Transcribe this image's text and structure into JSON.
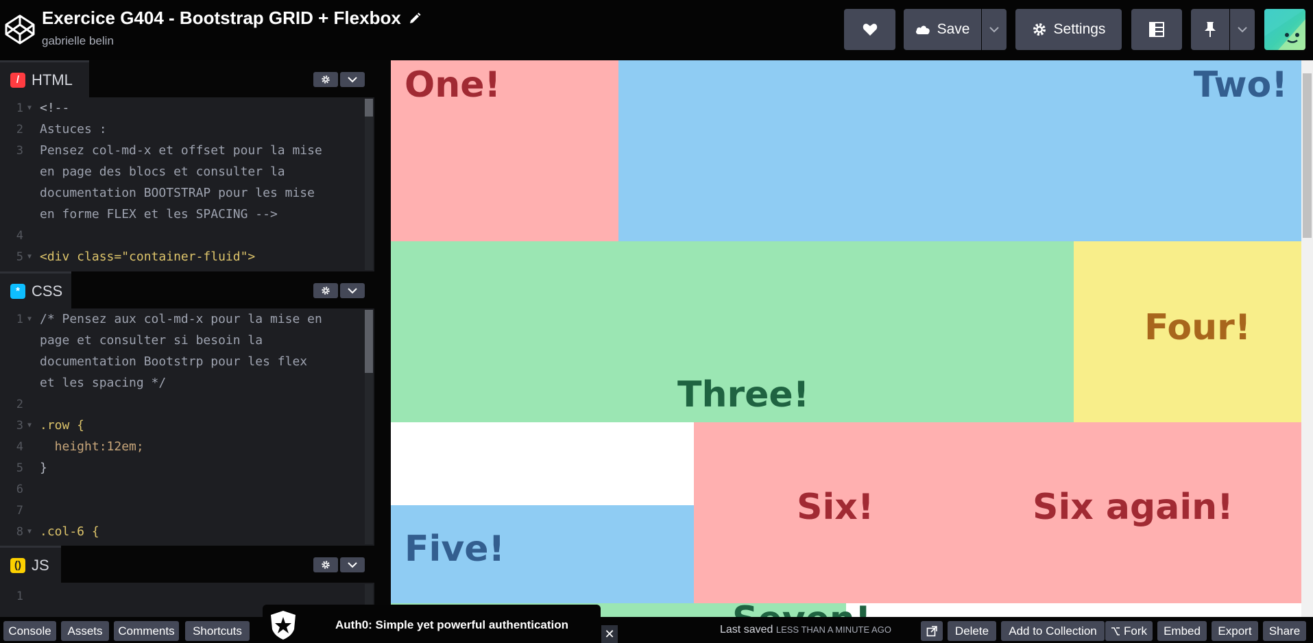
{
  "header": {
    "title": "Exercice G404 - Bootstrap GRID + Flexbox",
    "author": "gabrielle belin",
    "save_label": "Save",
    "settings_label": "Settings"
  },
  "editors": {
    "html": {
      "label": "HTML",
      "lines": [
        {
          "n": "1",
          "text": "<!--"
        },
        {
          "n": "2",
          "text": "Astuces :"
        },
        {
          "n": "3",
          "text": "Pensez col-md-x et offset pour la mise"
        },
        {
          "n": "",
          "text": "en page des blocs et consulter la"
        },
        {
          "n": "",
          "text": "documentation BOOTSTRAP pour les mise"
        },
        {
          "n": "",
          "text": "en forme FLEX et les SPACING -->"
        },
        {
          "n": "4",
          "text": ""
        },
        {
          "n": "5",
          "text": "<div class=\"container-fluid\">"
        }
      ]
    },
    "css": {
      "label": "CSS",
      "lines": [
        {
          "n": "1",
          "text": "/* Pensez aux col-md-x pour la mise en"
        },
        {
          "n": "",
          "text": "page et consulter si besoin la"
        },
        {
          "n": "",
          "text": "documentation Bootstrp pour les flex"
        },
        {
          "n": "",
          "text": "et les spacing */"
        },
        {
          "n": "2",
          "text": ""
        },
        {
          "n": "3",
          "text": ".row {"
        },
        {
          "n": "4",
          "text": "  height:12em;"
        },
        {
          "n": "5",
          "text": "}"
        },
        {
          "n": "6",
          "text": ""
        },
        {
          "n": "7",
          "text": ""
        },
        {
          "n": "8",
          "text": ".col-6 {"
        }
      ]
    },
    "js": {
      "label": "JS",
      "lines": [
        {
          "n": "1",
          "text": ""
        }
      ]
    }
  },
  "preview": {
    "one": "One!",
    "two": "Two!",
    "three": "Three!",
    "four": "Four!",
    "five": "Five!",
    "six": "Six!",
    "six_again": "Six again!",
    "seven_partial": "Seven!"
  },
  "footer": {
    "console": "Console",
    "assets": "Assets",
    "comments": "Comments",
    "shortcuts": "Shortcuts",
    "ad_text": "Auth0: Simple yet powerful authentication",
    "last_saved": "Last saved",
    "last_saved_when": "LESS THAN A MINUTE AGO",
    "delete": "Delete",
    "add_to_collection": "Add to Collection",
    "fork": "Fork",
    "embed": "Embed",
    "export": "Export",
    "share": "Share"
  },
  "colors": {
    "pink": "#ffb0b0",
    "blue": "#8fccf3",
    "green": "#9be6b3",
    "yellow": "#f8ee8a",
    "editor_bg": "#1d1e22",
    "button_bg": "#444857"
  }
}
